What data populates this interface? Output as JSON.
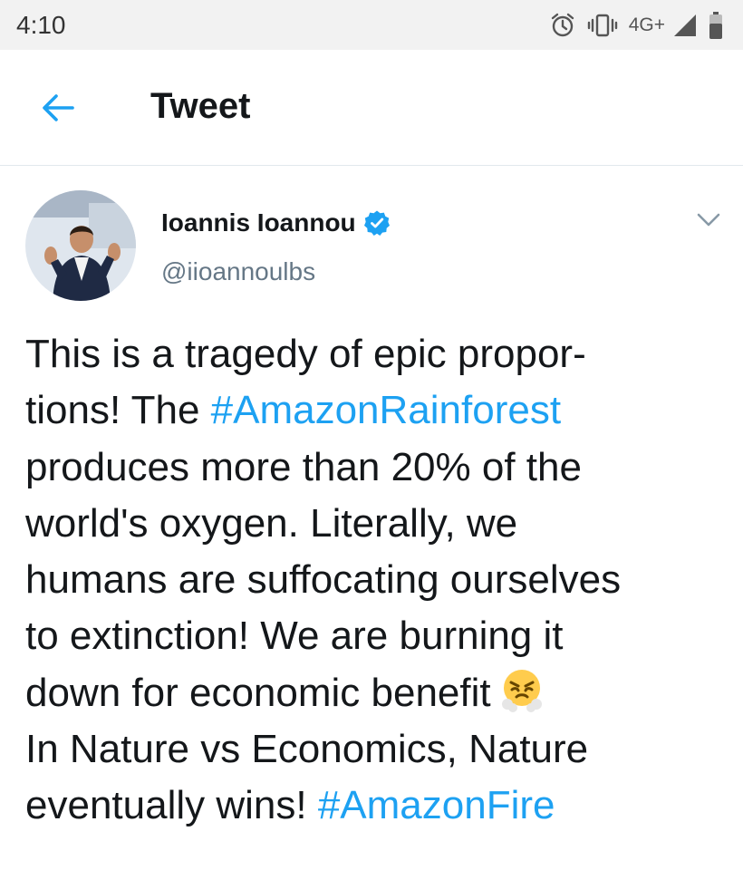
{
  "status_bar": {
    "time": "4:10",
    "network": "4G+",
    "icons": [
      "alarm-icon",
      "vibrate-icon",
      "signal-icon",
      "battery-icon"
    ]
  },
  "header": {
    "back_icon": "back-arrow-icon",
    "title": "Tweet"
  },
  "tweet": {
    "author_name": "Ioannis Ioannou",
    "verified": true,
    "handle": "@iioannoulbs",
    "more_icon": "chevron-down-icon",
    "lines": {
      "l1": "This is a tragedy of epic propor-",
      "l2_pre": "tions! The ",
      "l2_tag": "#AmazonRainforest",
      "l3": "produces more than 20% of the",
      "l4": "world's oxygen. Literally, we",
      "l5": "humans are suffocating ourselves",
      "l6": "to extinction! We are burning it",
      "l7": "down for economic benefit",
      "l7_emoji": "face-with-steam-from-nose",
      "l8": "In Nature vs Economics, Nature",
      "l9_pre": "eventually wins! ",
      "l9_tag": "#AmazonFire"
    }
  },
  "colors": {
    "accent": "#1da1f2",
    "text": "#14171a",
    "secondary": "#657786",
    "status_bar_bg": "#f2f2f2"
  }
}
